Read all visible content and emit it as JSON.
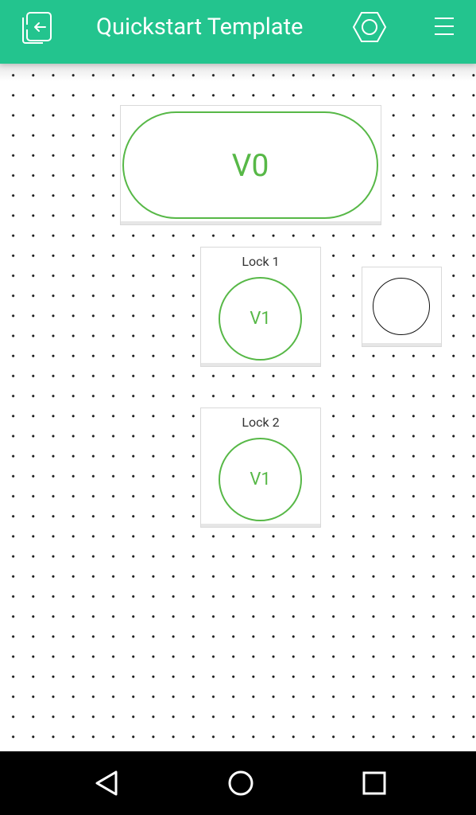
{
  "header": {
    "title": "Quickstart Template",
    "background_color": "#23c48e"
  },
  "icons": {
    "back": "exit-icon",
    "settings": "hexagon-nut-icon",
    "menu": "hamburger-menu-icon"
  },
  "widgets": {
    "button_v0": {
      "label": "V0"
    },
    "lock1": {
      "title": "Lock 1",
      "button_label": "V1"
    },
    "lock2": {
      "title": "Lock 2",
      "button_label": "V1"
    }
  },
  "colors": {
    "accent_green": "#57b847",
    "led_outline": "#111111"
  },
  "navbar": {
    "back": "triangle-back-icon",
    "home": "circle-home-icon",
    "recents": "square-recents-icon"
  }
}
